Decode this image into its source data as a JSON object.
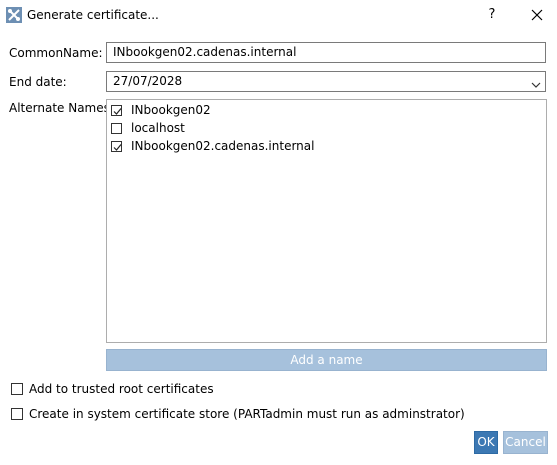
{
  "window": {
    "title": "Generate certificate...",
    "icon": "tools-icon",
    "help_label": "?",
    "close_icon": "close-icon"
  },
  "form": {
    "common_name_label": "CommonName:",
    "common_name_value": "INbookgen02.cadenas.internal",
    "end_date_label": "End date:",
    "end_date_value": "27/07/2028",
    "alternate_names_label": "Alternate Names:"
  },
  "alternate_names": [
    {
      "label": "INbookgen02",
      "checked": true
    },
    {
      "label": "localhost",
      "checked": false
    },
    {
      "label": "INbookgen02.cadenas.internal",
      "checked": true
    }
  ],
  "add_name_button": "Add a name",
  "options": {
    "trusted_root_label": "Add to trusted root certificates",
    "trusted_root_checked": false,
    "system_store_label": "Create in system certificate store (PARTadmin must run as adminstrator)",
    "system_store_checked": false
  },
  "buttons": {
    "ok": "OK",
    "cancel": "Cancel"
  },
  "colors": {
    "accent": "#3c78b3",
    "disabled_button": "#a6c1dc"
  }
}
